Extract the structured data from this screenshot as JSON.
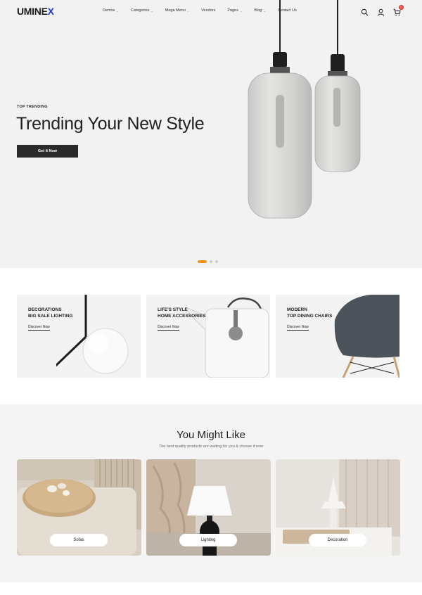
{
  "brand": {
    "name_main": "UMINE",
    "name_accent": "X"
  },
  "nav": [
    {
      "label": "Demos",
      "dropdown": true
    },
    {
      "label": "Categories",
      "dropdown": true
    },
    {
      "label": "Mega Menu",
      "dropdown": true
    },
    {
      "label": "Vendors",
      "dropdown": false
    },
    {
      "label": "Pages",
      "dropdown": true
    },
    {
      "label": "Blog",
      "dropdown": true
    },
    {
      "label": "Contact Us",
      "dropdown": false
    }
  ],
  "header_icons": [
    "search-icon",
    "user-icon",
    "cart-icon"
  ],
  "cart_count": "0",
  "hero": {
    "eyebrow": "TOP TRENDING",
    "title": "Trending Your New Style",
    "button": "Get It Now",
    "slides": 3,
    "active_slide": 1,
    "accent_color": "#f7941d"
  },
  "promos": [
    {
      "title": "DECORATIONS\nBIG SALE LIGHTING",
      "link": "Discover Now"
    },
    {
      "title": "LIFE'S STYLE\nHOME ACCESSORIES",
      "link": "Discover Now"
    },
    {
      "title": "MODERN\nTOP DINING CHAIRS",
      "link": "Discover Now"
    }
  ],
  "you_might_like": {
    "title": "You Might Like",
    "subtitle": "The best quality products are waiting for you & choose it now",
    "categories": [
      {
        "label": "Sofas"
      },
      {
        "label": "Lighting"
      },
      {
        "label": "Decoration"
      }
    ]
  }
}
